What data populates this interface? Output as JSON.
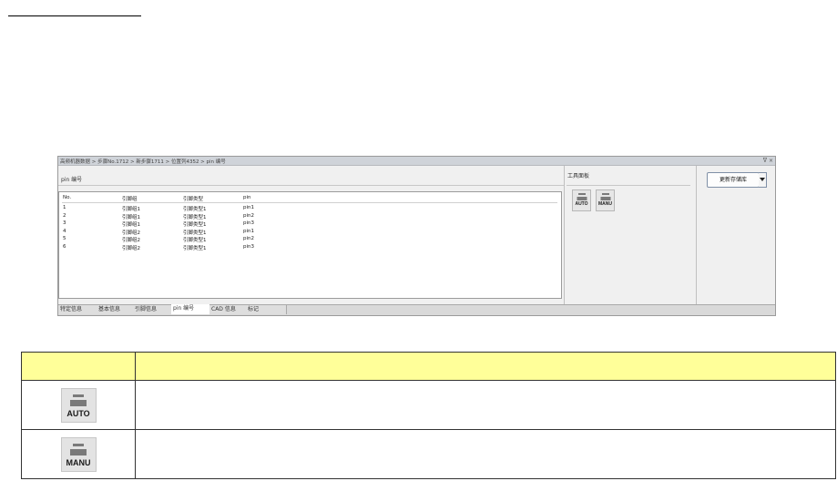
{
  "breadcrumb": "高频机器数据 > 步骤No.1712 > 新步骤1711 > 位置列4352 > pin 编号",
  "window_controls": {
    "pin": "ᐁ",
    "close": "×"
  },
  "main_pane": {
    "label": "pin 编号",
    "columns": [
      "No.",
      "引脚组",
      "引脚类型",
      "pin"
    ],
    "rows": [
      [
        "1",
        "引脚组1",
        "引脚类型1",
        "pin1"
      ],
      [
        "2",
        "引脚组1",
        "引脚类型1",
        "pin2"
      ],
      [
        "3",
        "引脚组1",
        "引脚类型1",
        "pin3"
      ],
      [
        "4",
        "引脚组2",
        "引脚类型1",
        "pin1"
      ],
      [
        "5",
        "引脚组2",
        "引脚类型1",
        "pin2"
      ],
      [
        "6",
        "引脚组2",
        "引脚类型1",
        "pin3"
      ]
    ]
  },
  "tool_pane": {
    "label": "工具面板",
    "buttons": [
      {
        "icon": "auto-icon",
        "text": "AUTO"
      },
      {
        "icon": "manu-icon",
        "text": "MANU"
      }
    ]
  },
  "right_pane": {
    "update_label": "更新存储库"
  },
  "tabs": [
    {
      "label": "特定信息",
      "active": false
    },
    {
      "label": "基本信息",
      "active": false
    },
    {
      "label": "引脚信息",
      "active": false
    },
    {
      "label": "pin 编号",
      "active": true
    },
    {
      "label": "CAD 信息",
      "active": false
    },
    {
      "label": "标记",
      "active": false
    }
  ],
  "legend": {
    "rows": [
      {
        "icon": "auto-icon",
        "text": "AUTO"
      },
      {
        "icon": "manu-icon",
        "text": "MANU"
      }
    ]
  },
  "colors": {
    "legend_header": "#ffff99",
    "titlebar": "#cfd3d9"
  }
}
